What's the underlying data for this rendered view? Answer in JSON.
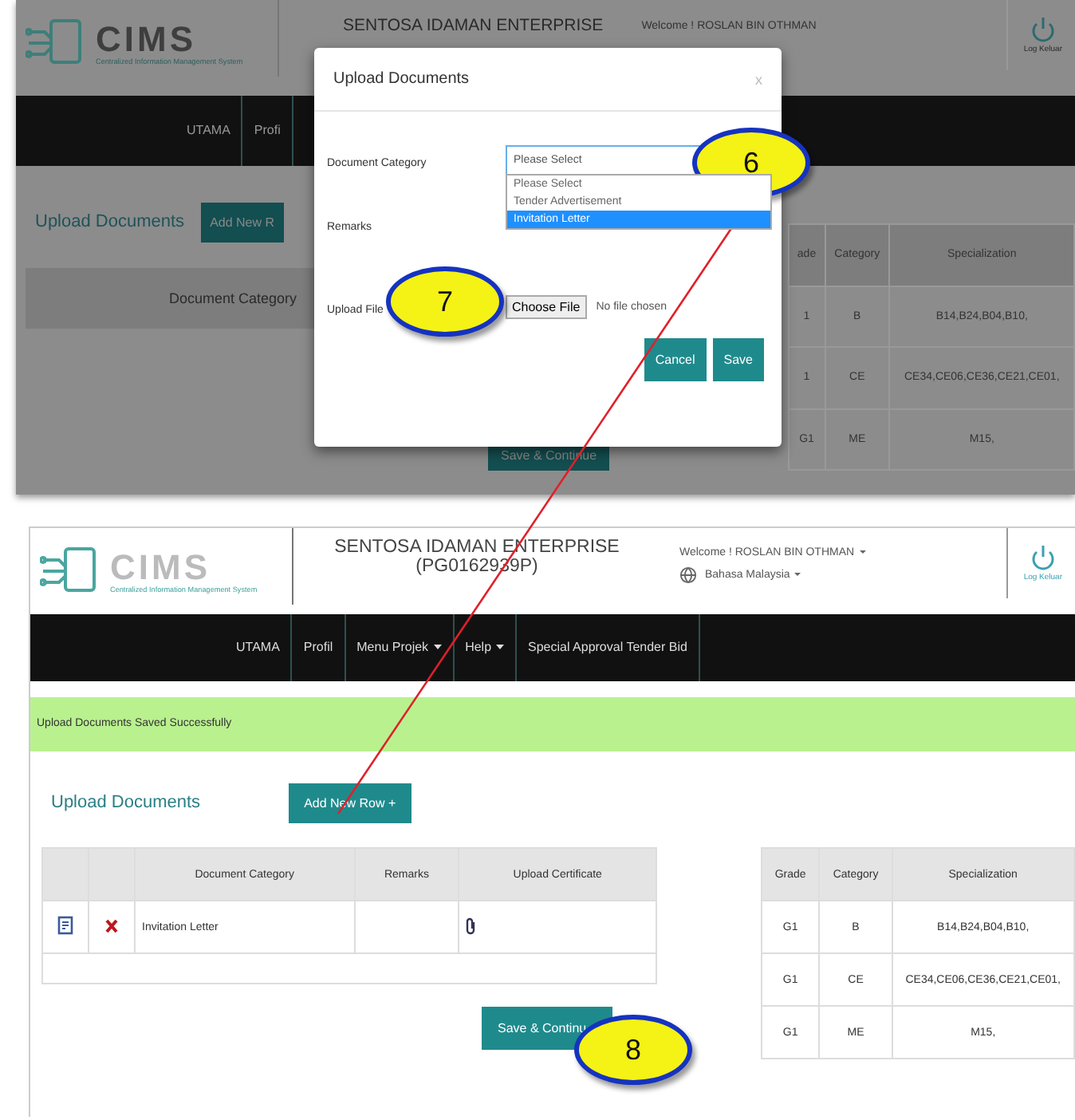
{
  "top_screen": {
    "header": {
      "logo_text": "CIMS",
      "logo_subtitle": "Centralized Information Management System",
      "company": "SENTOSA IDAMAN ENTERPRISE",
      "welcome": "Welcome ! ROSLAN BIN OTHMAN",
      "logout": "Log Keluar"
    },
    "nav": [
      "UTAMA",
      "Profi"
    ],
    "section_title": "Upload Documents",
    "add_button": "Add New R",
    "doc_table": {
      "columns": [
        "Document Category"
      ]
    },
    "grade_table": {
      "columns": [
        "ade",
        "Category",
        "Specialization"
      ],
      "rows": [
        [
          "1",
          "B",
          "B14,B24,B04,B10,"
        ],
        [
          "1",
          "CE",
          "CE34,CE06,CE36,CE21,CE01,"
        ],
        [
          "G1",
          "ME",
          "M15,"
        ]
      ]
    },
    "save_button": "Save & Continue",
    "modal": {
      "title": "Upload Documents",
      "close": "x",
      "fields": [
        {
          "kind": "select",
          "label": "Document Category",
          "placeholder": "Please Select"
        },
        {
          "kind": "text",
          "label": "Remarks"
        },
        {
          "kind": "file",
          "label": "Upload File",
          "button": "Choose File",
          "status": "No file chosen"
        }
      ],
      "options": [
        {
          "label": "Please Select",
          "selected": false
        },
        {
          "label": "Tender Advertisement",
          "selected": false
        },
        {
          "label": "Invitation Letter",
          "selected": true
        }
      ],
      "buttons": [
        "Cancel",
        "Save"
      ]
    }
  },
  "bottom_screen": {
    "header": {
      "logo_text": "CIMS",
      "logo_subtitle": "Centralized Information Management System",
      "company": "SENTOSA IDAMAN ENTERPRISE",
      "company_id": "(PG0162939P)",
      "welcome": "Welcome ! ROSLAN BIN OTHMAN",
      "language": "Bahasa Malaysia",
      "logout": "Log Keluar"
    },
    "nav": [
      {
        "label": "UTAMA",
        "dropdown": false
      },
      {
        "label": "Profil",
        "dropdown": false
      },
      {
        "label": "Menu Projek",
        "dropdown": true
      },
      {
        "label": "Help",
        "dropdown": true
      },
      {
        "label": "Special Approval Tender Bid",
        "dropdown": false
      }
    ],
    "alert": "Upload Documents Saved Successfully",
    "section_title": "Upload Documents",
    "add_button": "Add New Row +",
    "doc_table": {
      "columns": [
        "Document Category",
        "Remarks",
        "Upload Certificate"
      ],
      "rows": [
        {
          "category": "Invitation Letter",
          "remarks": ""
        }
      ]
    },
    "save_button": "Save & Continu",
    "grade_table": {
      "columns": [
        "Grade",
        "Category",
        "Specialization"
      ],
      "rows": [
        [
          "G1",
          "B",
          "B14,B24,B04,B10,"
        ],
        [
          "G1",
          "CE",
          "CE34,CE06,CE36,CE21,CE01,"
        ],
        [
          "G1",
          "ME",
          "M15,"
        ]
      ]
    }
  },
  "callouts": [
    "6",
    "7",
    "8"
  ]
}
